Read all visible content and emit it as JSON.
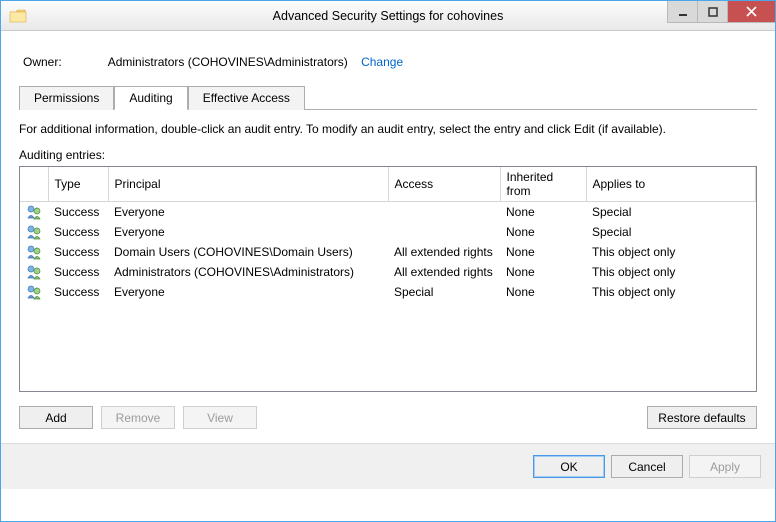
{
  "titlebar": {
    "title": "Advanced Security Settings for cohovines"
  },
  "owner": {
    "label": "Owner:",
    "value": "Administrators (COHOVINES\\Administrators)",
    "change": "Change"
  },
  "tabs": {
    "permissions": "Permissions",
    "auditing": "Auditing",
    "effective": "Effective Access"
  },
  "info_text": "For additional information, double-click an audit entry. To modify an audit entry, select the entry and click Edit (if available).",
  "entries_label": "Auditing entries:",
  "columns": {
    "icon": "",
    "type": "Type",
    "principal": "Principal",
    "access": "Access",
    "inherited": "Inherited from",
    "applies": "Applies to"
  },
  "rows": [
    {
      "type": "Success",
      "principal": "Everyone",
      "access": "",
      "inherited": "None",
      "applies": "Special"
    },
    {
      "type": "Success",
      "principal": "Everyone",
      "access": "",
      "inherited": "None",
      "applies": "Special"
    },
    {
      "type": "Success",
      "principal": "Domain Users (COHOVINES\\Domain Users)",
      "access": "All extended rights",
      "inherited": "None",
      "applies": "This object only"
    },
    {
      "type": "Success",
      "principal": "Administrators (COHOVINES\\Administrators)",
      "access": "All extended rights",
      "inherited": "None",
      "applies": "This object only"
    },
    {
      "type": "Success",
      "principal": "Everyone",
      "access": "Special",
      "inherited": "None",
      "applies": "This object only"
    }
  ],
  "buttons": {
    "add": "Add",
    "remove": "Remove",
    "view": "View",
    "restore": "Restore defaults",
    "ok": "OK",
    "cancel": "Cancel",
    "apply": "Apply"
  }
}
